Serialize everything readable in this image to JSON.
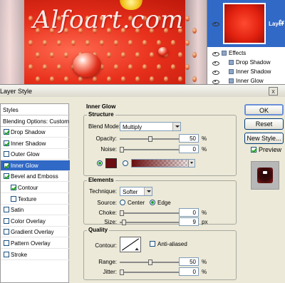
{
  "canvas": {
    "watermark": "Alfoart.com"
  },
  "layers": {
    "layer_name": "Layer ...",
    "fx": "fx",
    "effects_label": "Effects",
    "effects": [
      "Drop Shadow",
      "Inner Shadow",
      "Inner Glow"
    ]
  },
  "dialog": {
    "title": "Layer Style",
    "close": "x",
    "styles_header": "Styles",
    "blending_options": "Blending Options: Custom",
    "items": [
      {
        "label": "Drop Shadow",
        "checked": true
      },
      {
        "label": "Inner Shadow",
        "checked": true
      },
      {
        "label": "Outer Glow",
        "checked": false
      },
      {
        "label": "Inner Glow",
        "checked": true,
        "selected": true
      },
      {
        "label": "Bevel and Emboss",
        "checked": true
      },
      {
        "label": "Contour",
        "checked": true,
        "sub": true
      },
      {
        "label": "Texture",
        "checked": false,
        "sub": true
      },
      {
        "label": "Satin",
        "checked": false
      },
      {
        "label": "Color Overlay",
        "checked": false
      },
      {
        "label": "Gradient Overlay",
        "checked": false
      },
      {
        "label": "Pattern Overlay",
        "checked": false
      },
      {
        "label": "Stroke",
        "checked": false
      }
    ]
  },
  "inner_glow": {
    "heading": "Inner Glow",
    "structure": {
      "title": "Structure",
      "blend_mode_label": "Blend Mode:",
      "blend_mode_value": "Multiply",
      "opacity_label": "Opacity:",
      "opacity_value": "50",
      "opacity_fraction": 0.5,
      "noise_label": "Noise:",
      "noise_value": "0",
      "noise_fraction": 0,
      "percent": "%",
      "glow_color": "#6b0f12"
    },
    "elements": {
      "title": "Elements",
      "technique_label": "Technique:",
      "technique_value": "Softer",
      "source_label": "Source:",
      "center_label": "Center",
      "edge_label": "Edge",
      "choke_label": "Choke:",
      "choke_value": "0",
      "choke_fraction": 0,
      "size_label": "Size:",
      "size_value": "9",
      "size_fraction": 0.04,
      "percent": "%",
      "px": "px"
    },
    "quality": {
      "title": "Quality",
      "contour_label": "Contour:",
      "anti_aliased_label": "Anti-aliased",
      "range_label": "Range:",
      "range_value": "50",
      "range_fraction": 0.5,
      "jitter_label": "Jitter:",
      "jitter_value": "0",
      "jitter_fraction": 0,
      "percent": "%"
    }
  },
  "buttons": {
    "ok": "OK",
    "reset": "Reset",
    "new_style": "New Style...",
    "preview": "Preview"
  }
}
